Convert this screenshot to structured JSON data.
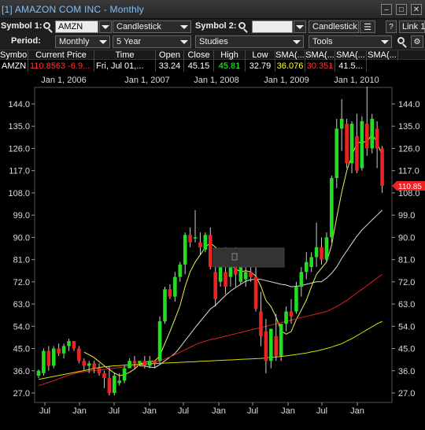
{
  "window": {
    "title": "[1] AMAZON COM INC - Monthly"
  },
  "toolbar": {
    "symbol1_label": "Symbol 1:",
    "symbol1_value": "AMZN",
    "chart_type1": "Candlestick",
    "symbol2_label": "Symbol 2:",
    "symbol2_value": "",
    "chart_type2": "Candlestick",
    "help_label": "?",
    "link_label": "Link 1",
    "period_label": "Period:",
    "period_value": "Monthly",
    "range_value": "5 Year",
    "studies_value": "Studies",
    "tools_value": "Tools"
  },
  "quote": {
    "headers": [
      "Symbol",
      "Current Price",
      "Time",
      "Open",
      "Close",
      "High",
      "Low",
      "SMA(...",
      "SMA(...",
      "SMA(...",
      "SMA(..."
    ],
    "row": [
      "AMZN",
      "110.8563 -6.9...",
      "Fri, Jul 01,...",
      "33.24",
      "45.15",
      "45.81",
      "32.79",
      "36.076",
      "30.351",
      "41.5..."
    ]
  },
  "colors": {
    "up": "#22dd22",
    "down": "#ee2222",
    "sma_short": "#eeee55",
    "sma_mid": "#dddddd",
    "sma_long_red": "#dd2222",
    "sma_long_yellow": "#dddd00",
    "price_tag": "#ee2222"
  },
  "chart_data": {
    "type": "candlestick",
    "title": "",
    "top_axis_labels": [
      "Jan 1, 2006",
      "Jan 1, 2007",
      "Jan 1, 2008",
      "Jan 1, 2009",
      "Jan 1, 2010"
    ],
    "bottom_axis_labels": [
      "Jul",
      "Jan",
      "Jul",
      "Jan",
      "Jul",
      "Jan",
      "Jul",
      "Jan",
      "Jul",
      "Jan"
    ],
    "y_ticks": [
      144.0,
      135.0,
      126.0,
      117.0,
      108.0,
      99.0,
      90.0,
      81.0,
      72.0,
      63.0,
      54.0,
      45.0,
      36.0,
      27.0
    ],
    "ylim": [
      24,
      148
    ],
    "last_price_label": "110.85",
    "last_price": 110.85,
    "candles": [
      {
        "o": 34,
        "h": 36.5,
        "l": 33,
        "c": 36
      },
      {
        "o": 35,
        "h": 45,
        "l": 34,
        "c": 44
      },
      {
        "o": 44,
        "h": 46,
        "l": 36,
        "c": 38
      },
      {
        "o": 38,
        "h": 46,
        "l": 37,
        "c": 45
      },
      {
        "o": 45,
        "h": 47,
        "l": 42,
        "c": 43
      },
      {
        "o": 43,
        "h": 47,
        "l": 41,
        "c": 46
      },
      {
        "o": 46,
        "h": 49,
        "l": 44,
        "c": 48
      },
      {
        "o": 48,
        "h": 48,
        "l": 44,
        "c": 45
      },
      {
        "o": 45,
        "h": 46,
        "l": 39,
        "c": 40
      },
      {
        "o": 40,
        "h": 41,
        "l": 36,
        "c": 38
      },
      {
        "o": 38,
        "h": 40,
        "l": 35,
        "c": 39
      },
      {
        "o": 39,
        "h": 40,
        "l": 35,
        "c": 37
      },
      {
        "o": 37,
        "h": 39,
        "l": 34,
        "c": 35
      },
      {
        "o": 35,
        "h": 36,
        "l": 29,
        "c": 33
      },
      {
        "o": 33,
        "h": 38,
        "l": 26,
        "c": 27
      },
      {
        "o": 27,
        "h": 35,
        "l": 26,
        "c": 34
      },
      {
        "o": 31,
        "h": 35,
        "l": 30,
        "c": 32
      },
      {
        "o": 32,
        "h": 38,
        "l": 31,
        "c": 37
      },
      {
        "o": 37,
        "h": 41,
        "l": 37,
        "c": 40
      },
      {
        "o": 40,
        "h": 42,
        "l": 37,
        "c": 39
      },
      {
        "o": 39,
        "h": 40,
        "l": 38,
        "c": 40
      },
      {
        "o": 40,
        "h": 42,
        "l": 37,
        "c": 38
      },
      {
        "o": 38,
        "h": 42,
        "l": 37,
        "c": 40
      },
      {
        "o": 40,
        "h": 40,
        "l": 37,
        "c": 39
      },
      {
        "o": 40,
        "h": 58,
        "l": 39,
        "c": 56
      },
      {
        "o": 56,
        "h": 70,
        "l": 55,
        "c": 69
      },
      {
        "o": 69,
        "h": 71,
        "l": 65,
        "c": 66
      },
      {
        "o": 66,
        "h": 76,
        "l": 64,
        "c": 74
      },
      {
        "o": 74,
        "h": 80,
        "l": 72,
        "c": 79
      },
      {
        "o": 79,
        "h": 92,
        "l": 75,
        "c": 91
      },
      {
        "o": 91,
        "h": 94,
        "l": 86,
        "c": 88
      },
      {
        "o": 90,
        "h": 101,
        "l": 88,
        "c": 90
      },
      {
        "o": 88,
        "h": 92,
        "l": 83,
        "c": 86
      },
      {
        "o": 85,
        "h": 92,
        "l": 84,
        "c": 91
      },
      {
        "o": 91,
        "h": 94,
        "l": 77,
        "c": 78
      },
      {
        "o": 76,
        "h": 82,
        "l": 62,
        "c": 65
      },
      {
        "o": 72,
        "h": 80,
        "l": 70,
        "c": 79
      },
      {
        "o": 76,
        "h": 86,
        "l": 67,
        "c": 70
      },
      {
        "o": 74,
        "h": 84,
        "l": 70,
        "c": 78
      },
      {
        "o": 78,
        "h": 86,
        "l": 70,
        "c": 75
      },
      {
        "o": 72,
        "h": 82,
        "l": 71,
        "c": 80
      },
      {
        "o": 73,
        "h": 80,
        "l": 70,
        "c": 76
      },
      {
        "o": 76,
        "h": 84,
        "l": 72,
        "c": 74
      },
      {
        "o": 74,
        "h": 78,
        "l": 60,
        "c": 61
      },
      {
        "o": 60,
        "h": 68,
        "l": 46,
        "c": 50
      },
      {
        "o": 52,
        "h": 57,
        "l": 35,
        "c": 40
      },
      {
        "o": 40,
        "h": 53,
        "l": 37,
        "c": 53
      },
      {
        "o": 50,
        "h": 59,
        "l": 40,
        "c": 42
      },
      {
        "o": 42,
        "h": 55,
        "l": 40,
        "c": 55
      },
      {
        "o": 55,
        "h": 62,
        "l": 52,
        "c": 60
      },
      {
        "o": 60,
        "h": 65,
        "l": 55,
        "c": 58
      },
      {
        "o": 60,
        "h": 72,
        "l": 59,
        "c": 70
      },
      {
        "o": 70,
        "h": 78,
        "l": 66,
        "c": 76
      },
      {
        "o": 76,
        "h": 84,
        "l": 73,
        "c": 80
      },
      {
        "o": 78,
        "h": 84,
        "l": 76,
        "c": 82
      },
      {
        "o": 82,
        "h": 96,
        "l": 78,
        "c": 86
      },
      {
        "o": 86,
        "h": 90,
        "l": 79,
        "c": 81
      },
      {
        "o": 81,
        "h": 92,
        "l": 80,
        "c": 90
      },
      {
        "o": 90,
        "h": 115,
        "l": 88,
        "c": 114
      },
      {
        "o": 114,
        "h": 138,
        "l": 110,
        "c": 134
      },
      {
        "o": 134,
        "h": 146,
        "l": 125,
        "c": 138
      },
      {
        "o": 136,
        "h": 138,
        "l": 118,
        "c": 120
      },
      {
        "o": 120,
        "h": 137,
        "l": 116,
        "c": 136
      },
      {
        "o": 131,
        "h": 140,
        "l": 116,
        "c": 117
      },
      {
        "o": 118,
        "h": 139,
        "l": 117,
        "c": 137
      },
      {
        "o": 136,
        "h": 151,
        "l": 123,
        "c": 126
      },
      {
        "o": 126,
        "h": 140,
        "l": 124,
        "c": 138
      },
      {
        "o": 134,
        "h": 137,
        "l": 118,
        "c": 126
      },
      {
        "o": 126,
        "h": 127,
        "l": 108,
        "c": 110.85
      }
    ],
    "series": [
      {
        "kind": "sma-short",
        "values": [
          null,
          null,
          null,
          null,
          null,
          null,
          null,
          null,
          null,
          43.5,
          42.5,
          41.3,
          39.7,
          38.0,
          36.5,
          35.1,
          34.0,
          34.4,
          35.4,
          36.7,
          38.6,
          39.4,
          39.8,
          39.9,
          42.1,
          47.1,
          51.8,
          57.0,
          62.4,
          70.1,
          76.1,
          80.0,
          82.9,
          86.0,
          87.8,
          86.0,
          84.5,
          81.4,
          78.5,
          77.3,
          76.0,
          76.5,
          76.0,
          74.3,
          70.2,
          64.5,
          62.0,
          57.8,
          52.2,
          50.8,
          51.9,
          56.7,
          60.5,
          64.6,
          70.1,
          75.0,
          77.5,
          80.0,
          86.9,
          98.0,
          108.3,
          117.0,
          123.1,
          128.2,
          128.7,
          128.6,
          131.8,
          128.5,
          123.0
        ]
      },
      {
        "kind": "sma-mid",
        "values": [
          null,
          null,
          null,
          null,
          null,
          null,
          null,
          null,
          null,
          null,
          null,
          null,
          null,
          null,
          null,
          null,
          null,
          null,
          null,
          null,
          38.0,
          37.9,
          37.5,
          37.3,
          38.5,
          40.0,
          41.5,
          43.0,
          45.5,
          48.2,
          50.8,
          53.5,
          56.0,
          58.5,
          61.0,
          62.5,
          64.5,
          66.5,
          68.3,
          69.7,
          71.0,
          72.3,
          72.8,
          73.2,
          73.0,
          72.5,
          72.0,
          71.5,
          71.0,
          70.7,
          70.0,
          70.2,
          70.5,
          71.0,
          71.5,
          72.0,
          72.0,
          73.5,
          75.5,
          78.0,
          81.5,
          84.5,
          87.5,
          90.5,
          93.0,
          95.0,
          97.0,
          99.0,
          101.0
        ]
      },
      {
        "kind": "sma-long-red",
        "values": [
          30.0,
          30.6,
          31.3,
          32.0,
          32.8,
          33.5,
          34.2,
          34.8,
          35.3,
          35.6,
          35.9,
          36.1,
          36.3,
          36.5,
          36.8,
          37.0,
          37.3,
          37.6,
          37.8,
          38.0,
          38.3,
          38.6,
          39.0,
          39.4,
          40.0,
          40.8,
          41.6,
          42.5,
          43.5,
          44.5,
          45.5,
          46.5,
          47.3,
          48.0,
          48.6,
          49.0,
          49.5,
          50.0,
          50.5,
          51.0,
          51.5,
          52.0,
          52.5,
          53.0,
          53.5,
          54.0,
          54.5,
          55.0,
          55.5,
          56.0,
          56.5,
          57.0,
          57.5,
          58.0,
          58.5,
          59.0,
          59.5,
          60.0,
          61.0,
          62.0,
          63.2,
          64.5,
          66.0,
          67.5,
          69.0,
          70.5,
          72.0,
          73.5,
          75.0
        ]
      },
      {
        "kind": "sma-long-yellow",
        "values": [
          32.5,
          32.9,
          33.3,
          33.7,
          34.1,
          34.5,
          34.9,
          35.3,
          35.7,
          36.1,
          36.5,
          36.9,
          37.3,
          37.6,
          37.8,
          38.0,
          38.1,
          38.3,
          38.4,
          38.5,
          38.6,
          38.7,
          38.8,
          38.9,
          39.0,
          39.1,
          39.2,
          39.3,
          39.4,
          39.5,
          39.6,
          39.7,
          39.8,
          39.9,
          40.0,
          40.1,
          40.2,
          40.3,
          40.4,
          40.5,
          40.6,
          40.7,
          40.8,
          40.9,
          41.0,
          41.2,
          41.4,
          41.6,
          41.8,
          42.0,
          42.3,
          42.6,
          42.9,
          43.2,
          43.6,
          44.0,
          44.5,
          45.0,
          45.6,
          46.3,
          47.0,
          48.0,
          49.0,
          50.2,
          51.4,
          52.6,
          53.8,
          55.0,
          56.0
        ]
      }
    ]
  }
}
